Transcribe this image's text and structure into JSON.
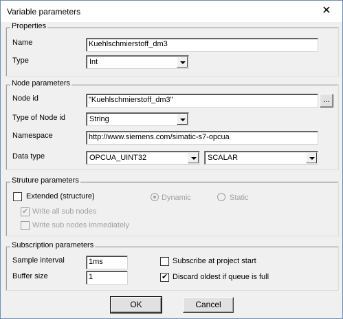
{
  "window": {
    "title": "Variable parameters",
    "close_glyph": "✕"
  },
  "properties": {
    "group_label": "Properties",
    "name_label": "Name",
    "name_value": "Kuehlschmierstoff_dm3",
    "type_label": "Type",
    "type_value": "Int"
  },
  "node": {
    "group_label": "Node parameters",
    "node_id_label": "Node id",
    "node_id_value": "\"Kuehlschmierstoff_dm3\"",
    "browse_label": "...",
    "type_of_node_id_label": "Type of Node id",
    "type_of_node_id_value": "String",
    "namespace_label": "Namespace",
    "namespace_value": "http://www.siemens.com/simatic-s7-opcua",
    "data_type_label": "Data type",
    "data_type_value": "OPCUA_UINT32",
    "data_shape_value": "SCALAR"
  },
  "structure": {
    "group_label": "Struture parameters",
    "extended_label": "Extended (structure)",
    "extended_checked": false,
    "write_all_label": "Write all sub nodes",
    "write_all_checked": true,
    "write_immediately_label": "Write sub nodes immediately",
    "write_immediately_checked": false,
    "dynamic_label": "Dynamic",
    "dynamic_selected": true,
    "static_label": "Static",
    "static_selected": false
  },
  "subscription": {
    "group_label": "Subscription parameters",
    "sample_interval_label": "Sample interval",
    "sample_interval_value": "1ms",
    "buffer_size_label": "Buffer size",
    "buffer_size_value": "1",
    "subscribe_start_label": "Subscribe at project start",
    "subscribe_start_checked": false,
    "discard_oldest_label": "Discard oldest if queue is full",
    "discard_oldest_checked": true
  },
  "buttons": {
    "ok_label": "OK",
    "cancel_label": "Cancel"
  },
  "icons": {
    "check_glyph": "✔"
  }
}
